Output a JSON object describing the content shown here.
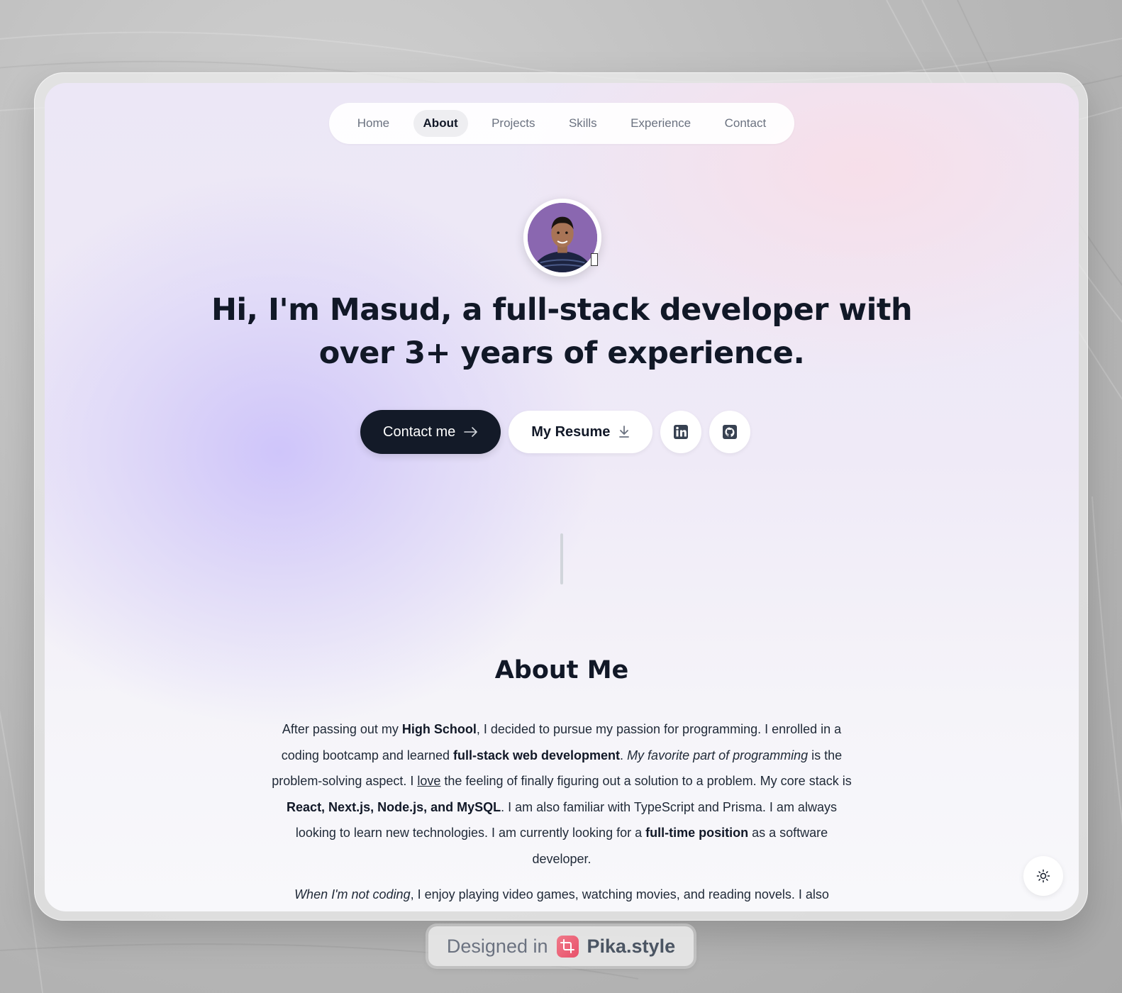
{
  "nav": {
    "items": [
      {
        "label": "Home",
        "active": false
      },
      {
        "label": "About",
        "active": true
      },
      {
        "label": "Projects",
        "active": false
      },
      {
        "label": "Skills",
        "active": false
      },
      {
        "label": "Experience",
        "active": false
      },
      {
        "label": "Contact",
        "active": false
      }
    ]
  },
  "hero": {
    "line1_a": "Hi, I'm Masud,",
    "line1_b": " a ",
    "line1_c": "full-stack developer",
    "line1_d": " with",
    "line2_a": "over 3+ years",
    "line2_b": " of experience.",
    "wave_glyph": "▯"
  },
  "actions": {
    "contact_label": "Contact me",
    "contact_icon": "arrow-right-icon",
    "resume_label": "My Resume",
    "resume_icon": "download-icon",
    "linkedin_icon": "linkedin-icon",
    "github_icon": "github-icon"
  },
  "about": {
    "title": "About Me",
    "p1": {
      "t1": "After passing out my ",
      "b1": "High School",
      "t2": ", I decided to pursue my passion for programming. I enrolled in a coding bootcamp and learned ",
      "b2": "full-stack web development",
      "t3": ". ",
      "i1": "My favorite part of programming",
      "t4": " is the problem-solving aspect. I ",
      "u1": "love",
      "t5": " the feeling of finally figuring out a solution to a problem. My core stack is ",
      "b3": "React, Next.js, Node.js, and MySQL",
      "t6": ". I am also familiar with TypeScript and Prisma. I am always looking to learn new technologies. I am currently looking for a ",
      "b4": "full-time position",
      "t7": " as a software developer."
    },
    "p2": {
      "i1": "When I'm not coding",
      "t1": ", I enjoy playing video games, watching movies, and reading novels. I also"
    }
  },
  "theme_toggle_icon": "sun-icon",
  "badge": {
    "prefix": "Designed in",
    "brand": "Pika.style",
    "logo_icon": "crop-icon"
  },
  "colors": {
    "primary_button": "#131a28",
    "badge_logo": "#e8506a",
    "accent_lavender": "#cdc3fa"
  }
}
